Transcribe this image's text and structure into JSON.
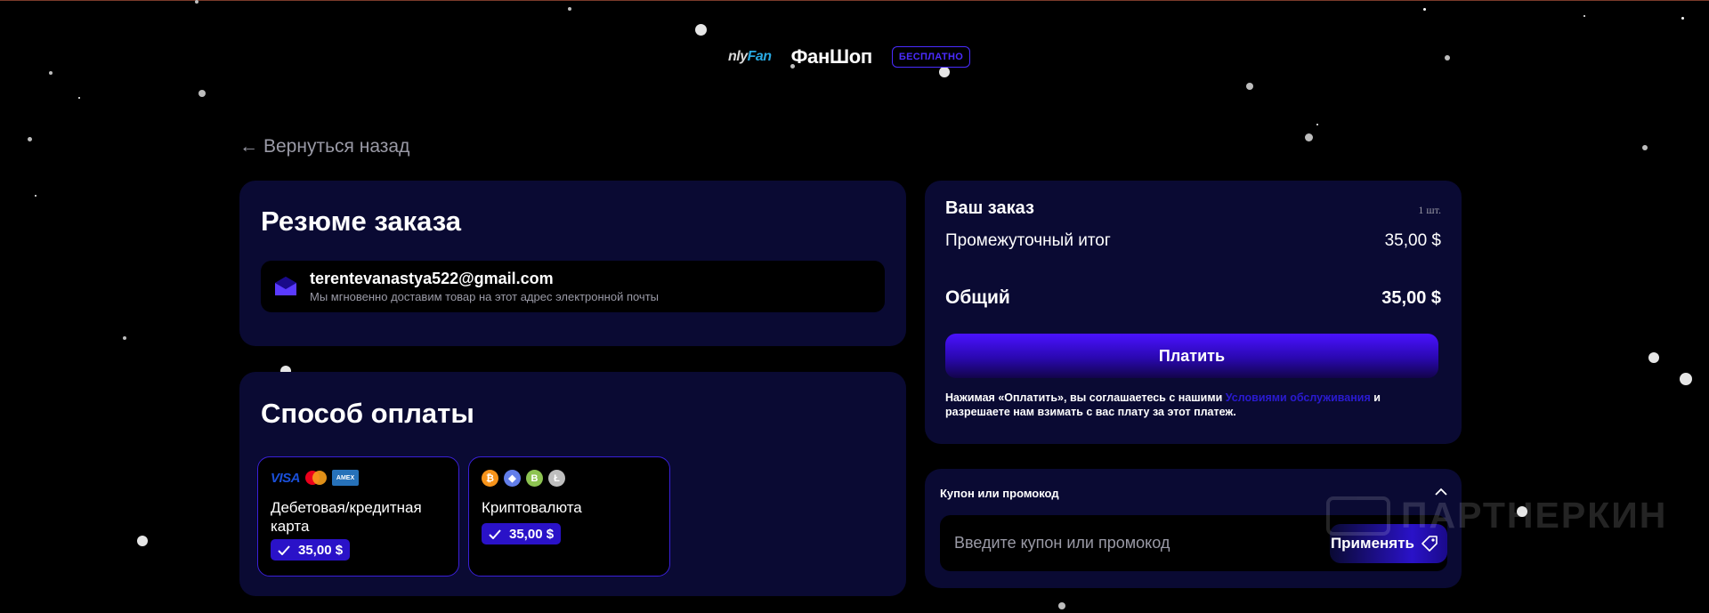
{
  "header": {
    "logo_of_prefix": "nly",
    "logo_of_fan": "Fan",
    "logo_shop": "ФанШоп",
    "free_badge": "БЕСПЛАТНО"
  },
  "back": {
    "label": "Вернуться назад"
  },
  "summary": {
    "title": "Резюме заказа",
    "email": "terentevanastya522@gmail.com",
    "email_note": "Мы мгновенно доставим товар на этот адрес электронной почты"
  },
  "payment": {
    "title": "Способ оплаты",
    "methods": [
      {
        "label": "Дебетовая/кредитная карта",
        "price": "35,00 $",
        "icons": [
          "visa-icon",
          "mastercard-icon",
          "amex-icon"
        ]
      },
      {
        "label": "Криптовалюта",
        "price": "35,00 $",
        "icons": [
          "bitcoin-icon",
          "ethereum-icon",
          "bitcoin-cash-icon",
          "litecoin-icon"
        ]
      }
    ],
    "visa_text": "VISA",
    "amex_text": "AMEX",
    "coin_btc": "₿",
    "coin_eth": "◆",
    "coin_bch": "B",
    "coin_ltc": "Ł"
  },
  "order": {
    "title": "Ваш заказ",
    "qty": "1 шт.",
    "subtotal_label": "Промежуточный итог",
    "subtotal_value": "35,00 $",
    "total_label": "Общий",
    "total_value": "35,00 $",
    "pay_button": "Платить",
    "terms_before": "Нажимая «Оплатить», вы соглашаетесь с нашими",
    "terms_link": "Условиями обслуживания",
    "terms_after": "и разрешаете нам взимать с вас плату за этот платеж."
  },
  "coupon": {
    "title": "Купон или промокод",
    "placeholder": "Введите купон или промокод",
    "apply_label": "Применять"
  },
  "watermark": {
    "text": "ПАРТНЕРКИН"
  },
  "colors": {
    "background": "#000000",
    "panel": "#0a0a33",
    "accent": "#2a12c8",
    "accent_bright": "#4a2cff",
    "muted_text": "#9a9aa6"
  }
}
